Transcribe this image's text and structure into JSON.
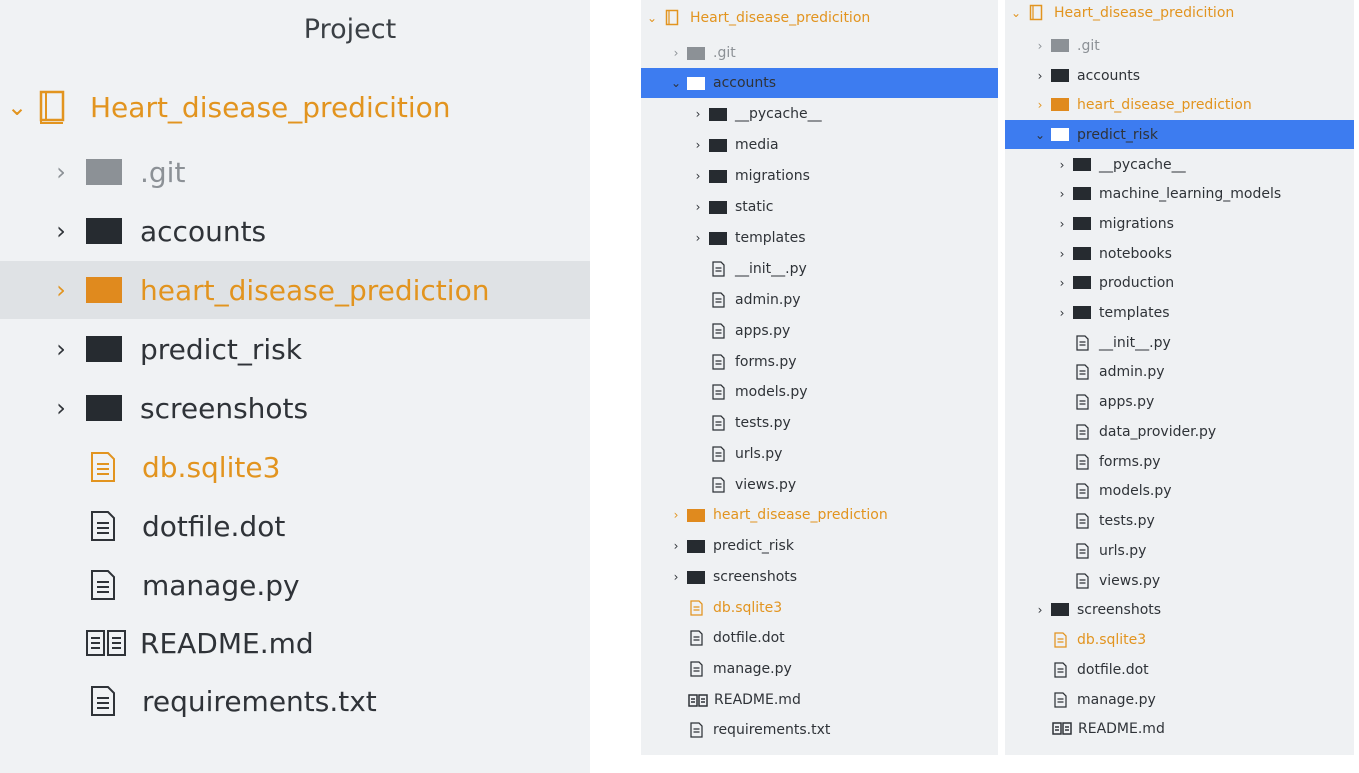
{
  "project_panel": {
    "title": "Project",
    "root": "Heart_disease_predicition",
    "items": [
      ".git",
      "accounts",
      "heart_disease_prediction",
      "predict_risk",
      "screenshots",
      "db.sqlite3",
      "dotfile.dot",
      "manage.py",
      "README.md",
      "requirements.txt"
    ]
  },
  "accounts_panel": {
    "root": "Heart_disease_predicition",
    "items": [
      ".git",
      "accounts",
      "__pycache__",
      "media",
      "migrations",
      "static",
      "templates",
      "__init__.py",
      "admin.py",
      "apps.py",
      "forms.py",
      "models.py",
      "tests.py",
      "urls.py",
      "views.py",
      "heart_disease_prediction",
      "predict_risk",
      "screenshots",
      "db.sqlite3",
      "dotfile.dot",
      "manage.py",
      "README.md",
      "requirements.txt"
    ]
  },
  "predict_risk_panel": {
    "root": "Heart_disease_predicition",
    "items": [
      ".git",
      "accounts",
      "heart_disease_prediction",
      "predict_risk",
      "__pycache__",
      "machine_learning_models",
      "migrations",
      "notebooks",
      "production",
      "templates",
      "__init__.py",
      "admin.py",
      "apps.py",
      "data_provider.py",
      "forms.py",
      "models.py",
      "tests.py",
      "urls.py",
      "views.py",
      "screenshots",
      "db.sqlite3",
      "dotfile.dot",
      "manage.py",
      "README.md"
    ]
  },
  "colors": {
    "selection": "#3d7cf0",
    "accent_orange": "#e2941f",
    "panel_bg": "#f0f2f4",
    "hover_bg": "#dfe2e5"
  },
  "icons": {
    "root": "book-icon",
    "folder": "folder-icon",
    "file": "file-icon",
    "readme": "readme-icon",
    "expand": "chevron-right-icon",
    "collapse": "chevron-down-icon"
  }
}
